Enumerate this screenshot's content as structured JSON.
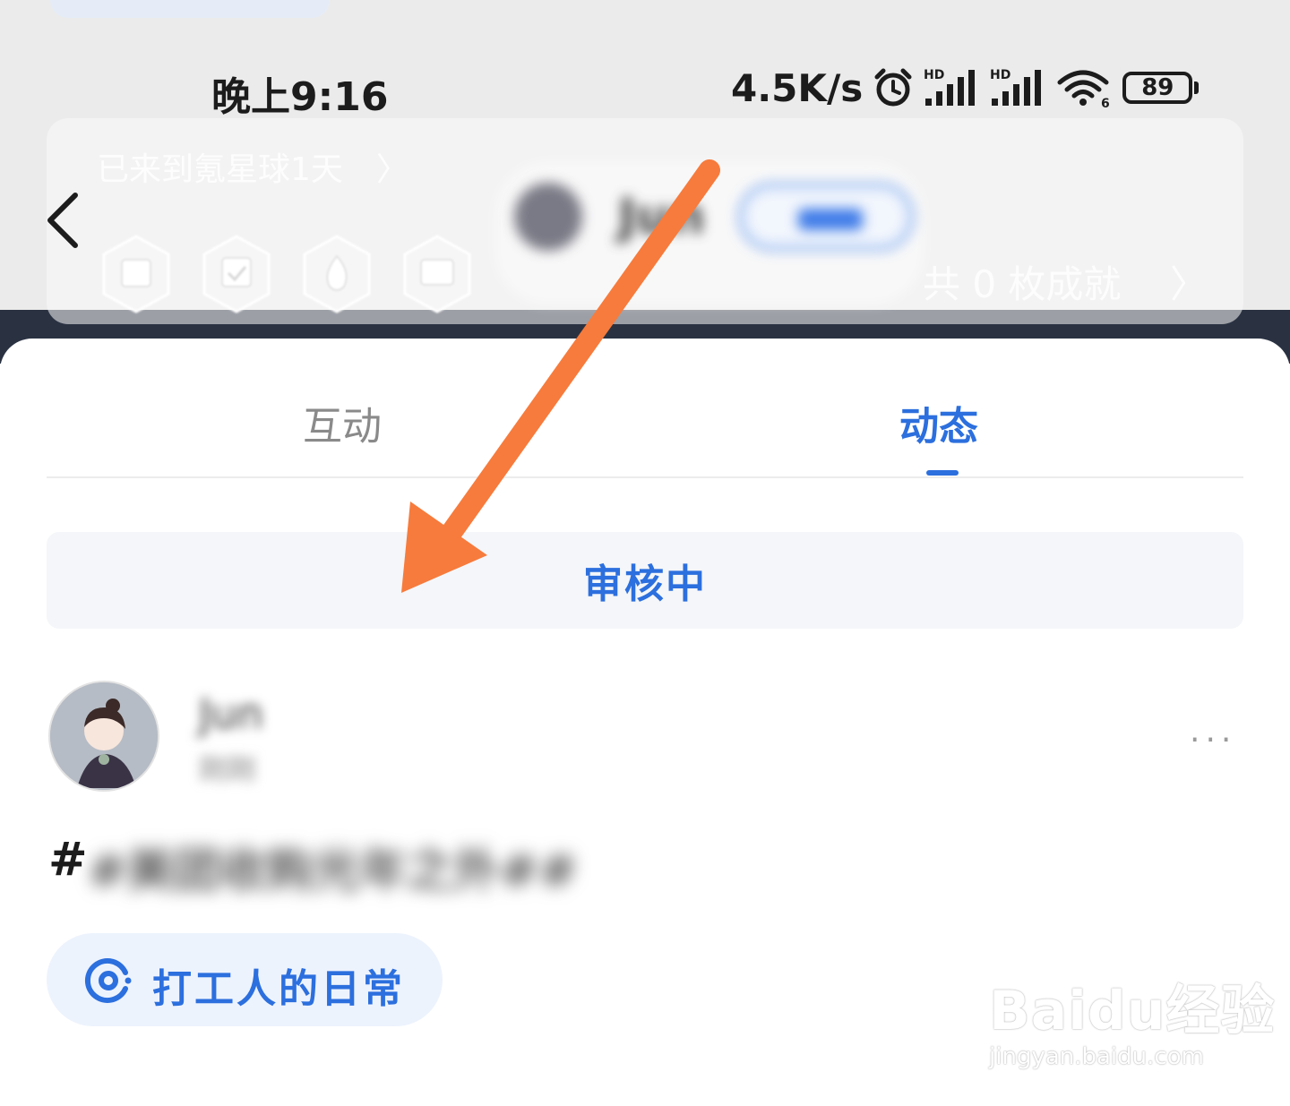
{
  "status_bar": {
    "time": "晚上9:16",
    "net_speed": "4.5K/s",
    "battery": "89",
    "signal_label_1": "HD",
    "signal_label_2": "HD",
    "wifi_label": "6"
  },
  "profile_header": {
    "arrive_text": "已来到氪星球1天",
    "chevron": "〉",
    "achievements_text": "共 0 枚成就",
    "user_name_blurred": "Jun",
    "badges": [
      "badge-1",
      "badge-2",
      "badge-3",
      "badge-4"
    ]
  },
  "tabs": [
    {
      "label": "互动",
      "active": false
    },
    {
      "label": "动态",
      "active": true
    }
  ],
  "review_status": "审核中",
  "post": {
    "author_name": "Jun",
    "author_sub": "刚刚",
    "more": "···",
    "hashtag_prefix": "#",
    "hashtag_text": "#美团收购光年之外##",
    "topic_chip": "打工人的日常"
  },
  "watermark": {
    "logo": "Baidu经验",
    "url": "jingyan.baidu.com"
  },
  "colors": {
    "accent": "#2c6fde",
    "arrow": "#f77b3c",
    "tab_inactive": "#8a8a8a",
    "review_bg": "#f4f6f9",
    "chip_bg": "#edf3fd"
  },
  "icons": [
    "back-chevron-icon",
    "alarm-icon",
    "signal-icon",
    "wifi-icon",
    "battery-icon",
    "topic-icon",
    "more-icon",
    "annotation-arrow"
  ]
}
